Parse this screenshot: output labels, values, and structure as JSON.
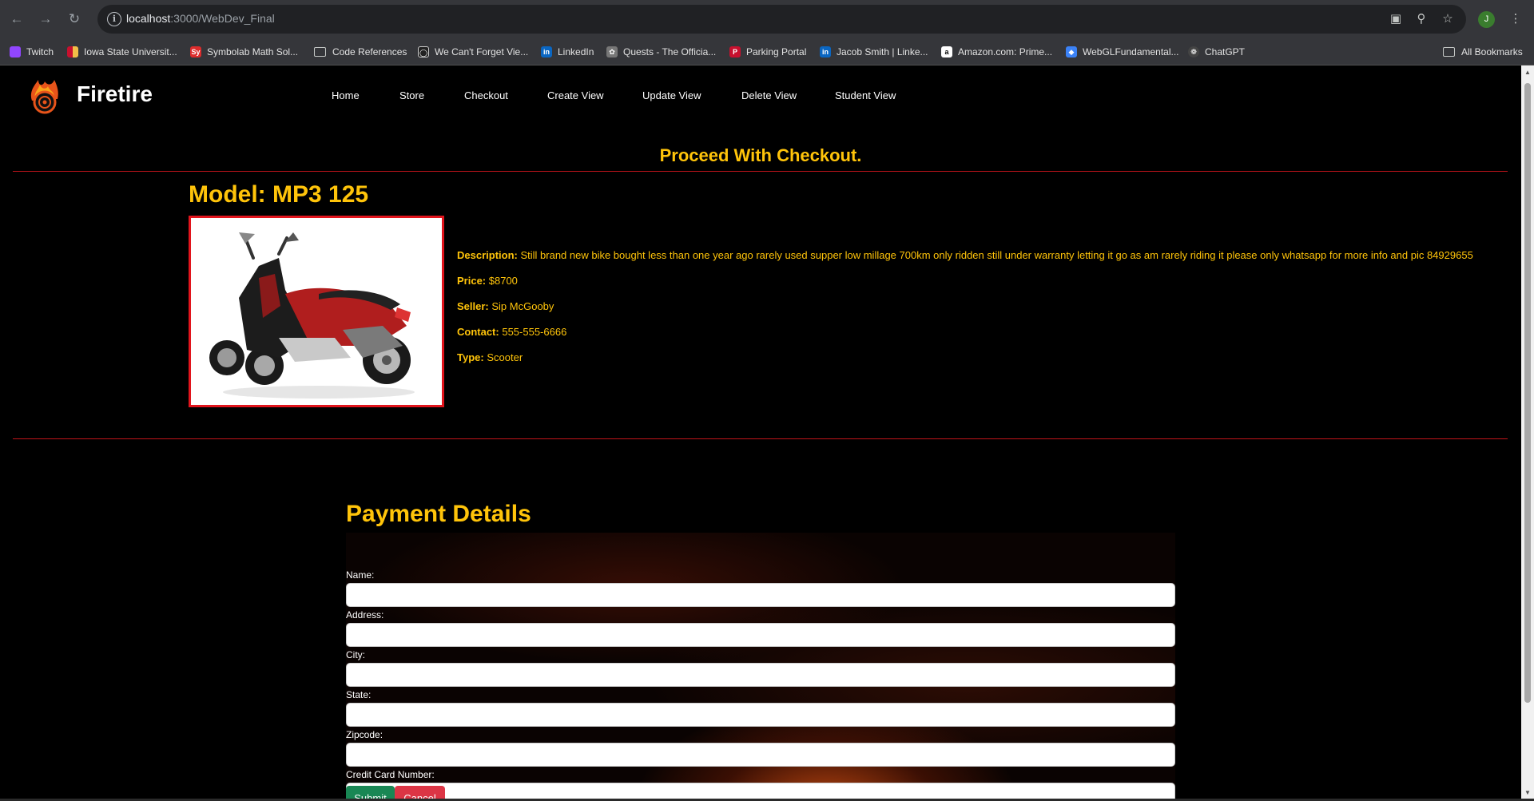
{
  "browser": {
    "url_host": "localhost",
    "url_rest": ":3000/WebDev_Final",
    "profile_initial": "J"
  },
  "bookmarks": [
    {
      "label": "Twitch",
      "icon": "twitch-icon",
      "color": "#9146ff"
    },
    {
      "label": "Iowa State Universit...",
      "icon": "isu-icon",
      "color": "#c8102e"
    },
    {
      "label": "Symbolab Math Sol...",
      "icon": "symbolab-icon",
      "color": "#dd2c2c"
    },
    {
      "label": "Code References",
      "icon": "folder-icon"
    },
    {
      "label": "We Can't Forget Vie...",
      "icon": "wcf-icon",
      "color": "#222"
    },
    {
      "label": "LinkedIn",
      "icon": "linkedin-icon",
      "color": "#0a66c2"
    },
    {
      "label": "Quests - The Officia...",
      "icon": "quests-icon",
      "color": "#777"
    },
    {
      "label": "Parking Portal",
      "icon": "parking-icon",
      "color": "#c8102e"
    },
    {
      "label": "Jacob Smith | Linke...",
      "icon": "linkedin-icon",
      "color": "#0a66c2"
    },
    {
      "label": "Amazon.com: Prime...",
      "icon": "amazon-icon",
      "color": "#fff"
    },
    {
      "label": "WebGLFundamental...",
      "icon": "webgl-icon",
      "color": "#3b82f6"
    },
    {
      "label": "ChatGPT",
      "icon": "chatgpt-icon",
      "color": "#444"
    }
  ],
  "all_bookmarks_label": "All Bookmarks",
  "site": {
    "brand": "Firetire",
    "nav": [
      "Home",
      "Store",
      "Checkout",
      "Create View",
      "Update View",
      "Delete View",
      "Student View"
    ]
  },
  "checkout": {
    "title": "Proceed With Checkout.",
    "model_title": "Model: MP3 125",
    "description_label": "Description:",
    "description": "Still brand new bike bought less than one year ago rarely used supper low millage 700km only ridden still under warranty letting it go as am rarely riding it please only whatsapp for more info and pic 84929655",
    "price_label": "Price:",
    "price": "$8700",
    "seller_label": "Seller:",
    "seller": "Sip McGooby",
    "contact_label": "Contact:",
    "contact": "555-555-6666",
    "type_label": "Type:",
    "type": "Scooter"
  },
  "payment": {
    "title": "Payment Details",
    "fields": [
      "Name:",
      "Address:",
      "City:",
      "State:",
      "Zipcode:",
      "Credit Card Number:"
    ],
    "submit_label": "Submit",
    "cancel_label": "Cancel"
  },
  "colors": {
    "accent_yellow": "#ffc40a",
    "divider_red": "#c0141a",
    "submit_green": "#198754",
    "cancel_red": "#dc3545"
  }
}
